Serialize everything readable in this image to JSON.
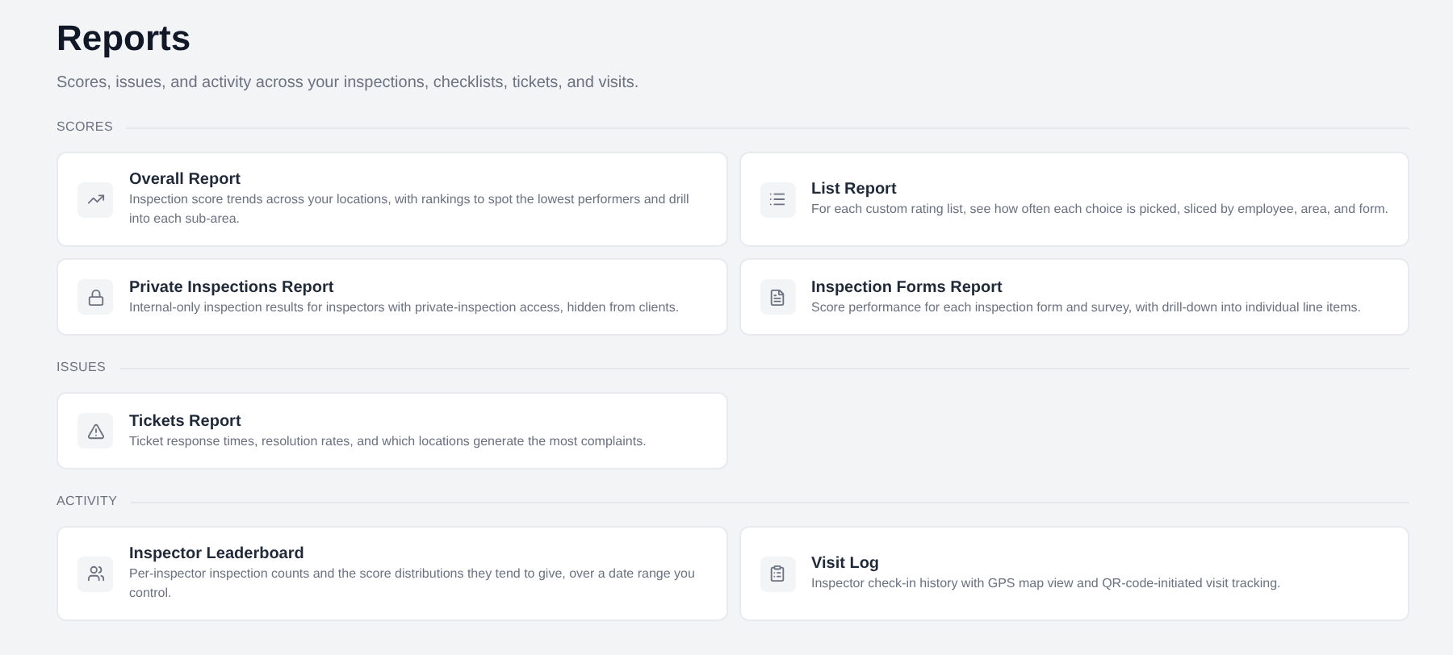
{
  "header": {
    "title": "Reports",
    "subtitle": "Scores, issues, and activity across your inspections, checklists, tickets, and visits."
  },
  "sections": [
    {
      "label": "SCORES",
      "reports": [
        {
          "kind": "chart",
          "title": "Overall Report",
          "description": "Inspection score trends across your locations, with rankings to spot the lowest performers and drill into each sub-area."
        },
        {
          "kind": "list",
          "title": "List Report",
          "description": "For each custom rating list, see how often each choice is picked, sliced by employee, area, and form."
        },
        {
          "kind": "lock",
          "title": "Private Inspections Report",
          "description": "Internal-only inspection results for inspectors with private-inspection access, hidden from clients."
        },
        {
          "kind": "document",
          "title": "Inspection Forms Report",
          "description": "Score performance for each inspection form and survey, with drill-down into individual line items."
        }
      ]
    },
    {
      "label": "ISSUES",
      "reports": [
        {
          "kind": "warning",
          "title": "Tickets Report",
          "description": "Ticket response times, resolution rates, and which locations generate the most complaints."
        }
      ]
    },
    {
      "label": "ACTIVITY",
      "reports": [
        {
          "kind": "people",
          "title": "Inspector Leaderboard",
          "description": "Per-inspector inspection counts and the score distributions they tend to give, over a date range you control."
        },
        {
          "kind": "clipboard",
          "title": "Visit Log",
          "description": "Inspector check-in history with GPS map view and QR-code-initiated visit tracking."
        }
      ]
    }
  ]
}
